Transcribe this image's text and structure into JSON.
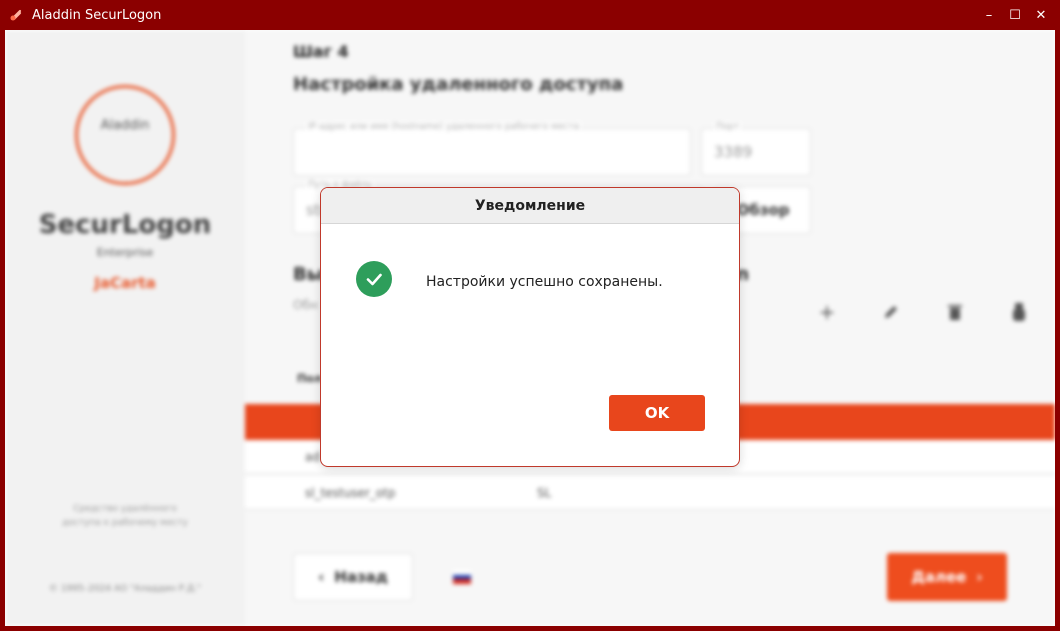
{
  "window": {
    "title": "Aladdin SecurLogon",
    "controls": {
      "minimize": "–",
      "maximize": "☐",
      "close": "✕"
    }
  },
  "sidebar": {
    "logo_text": "Aladdin",
    "brand": "SecurLogon",
    "edition": "Enterprise",
    "product": "JaCarta",
    "note": "Средство удалённого доступа к рабочему месту",
    "copyright": "© 1995–2024 АО \"Аладдин Р.Д.\""
  },
  "main": {
    "step": "Шаг 4",
    "heading": "Настройка удаленного доступа",
    "address_field": {
      "label": "IP-адрес или имя (hostname) удаленного рабочего места",
      "value": ""
    },
    "port_field": {
      "label": "Порт",
      "value": "3389"
    },
    "path_field": {
      "label": "Путь к файлу",
      "value": "str"
    },
    "browse_label": "Обзор",
    "section_title": "Вы",
    "section_title_tail": "gon",
    "section_desc": "Обн",
    "column_header": "Пол",
    "rows": [
      {
        "c1": "ad",
        "c2": ""
      },
      {
        "c1": "sl_testuser_otp",
        "c2": "SL"
      }
    ],
    "back_label": "Назад",
    "next_label": "Далее"
  },
  "dialog": {
    "title": "Уведомление",
    "message": "Настройки успешно сохранены.",
    "ok_label": "OK"
  },
  "colors": {
    "titlebar": "#8b0000",
    "accent": "#e8461c",
    "success": "#2e9e5b"
  }
}
